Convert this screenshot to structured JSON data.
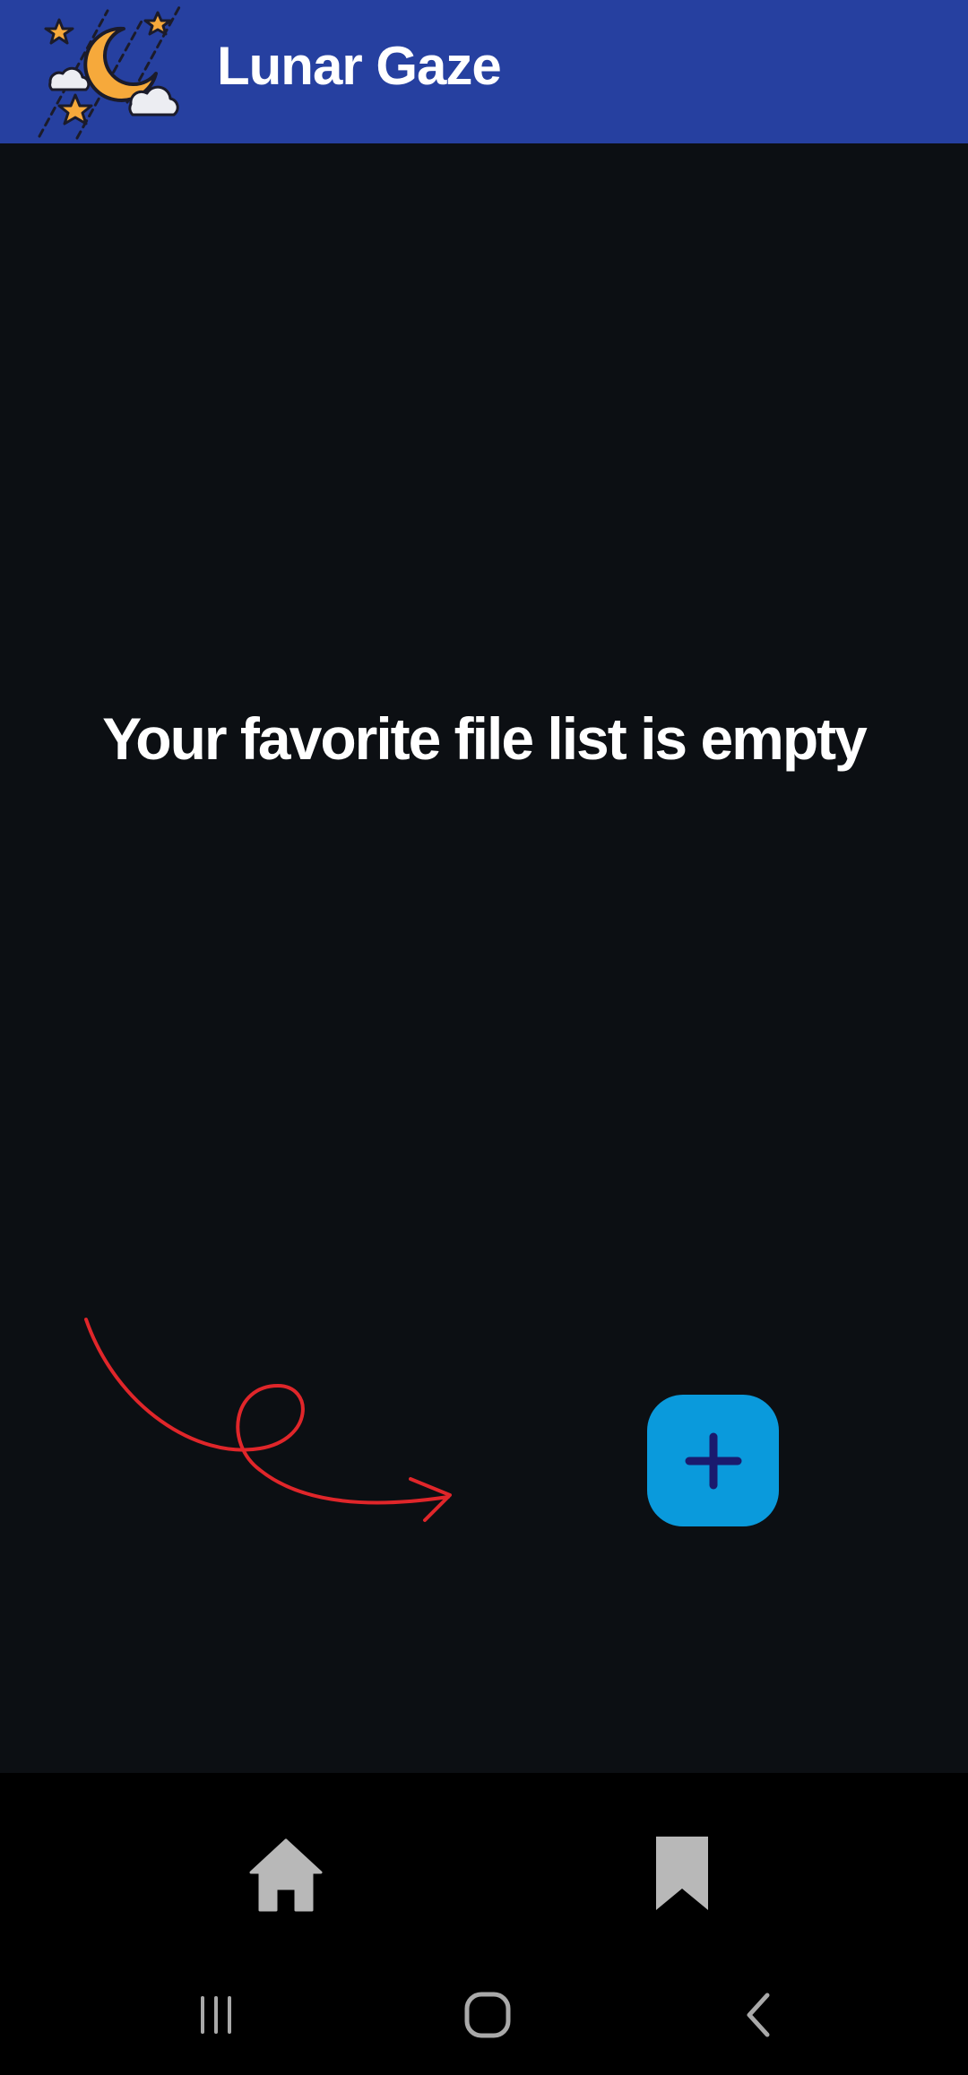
{
  "app_bar": {
    "title": "Lunar Gaze",
    "logo_icon": "moon-stars-clouds-icon",
    "background": "#2640a0"
  },
  "main": {
    "empty_message": "Your favorite file list is empty",
    "doodle_icon": "curly-arrow-icon",
    "doodle_color": "#e0262a",
    "background": "#0c0f13"
  },
  "fab": {
    "icon": "plus-icon",
    "background": "#0a9adc",
    "icon_color": "#1a1a6e"
  },
  "bottom_nav": {
    "items": [
      {
        "icon": "home-icon"
      },
      {
        "icon": "bookmark-icon"
      }
    ],
    "icon_color": "#b8b8b8"
  },
  "system_nav": {
    "buttons": [
      {
        "icon": "recents-icon"
      },
      {
        "icon": "home-outline-icon"
      },
      {
        "icon": "back-chevron-icon"
      }
    ]
  }
}
